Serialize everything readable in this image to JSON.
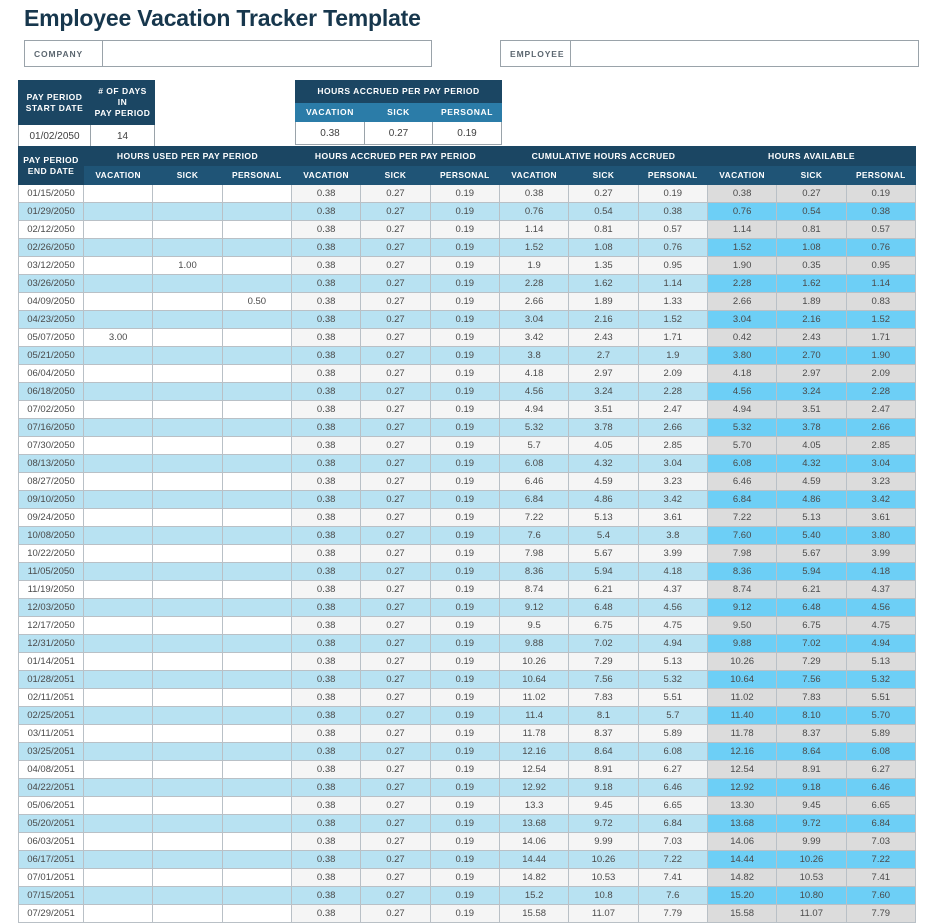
{
  "page_title": "Employee Vacation Tracker Template",
  "identity": {
    "company_label": "COMPANY",
    "company_value": "",
    "employee_label": "EMPLOYEE",
    "employee_value": ""
  },
  "pay_period_table": {
    "headers": [
      "PAY PERIOD START DATE",
      "# OF DAYS IN PAY PERIOD"
    ],
    "header_lines": [
      [
        "PAY PERIOD",
        "START DATE"
      ],
      [
        "# OF DAYS IN",
        "PAY PERIOD"
      ]
    ],
    "values": [
      "01/02/2050",
      "14"
    ]
  },
  "accrual_table": {
    "title": "HOURS ACCRUED PER PAY PERIOD",
    "columns": [
      "VACATION",
      "SICK",
      "PERSONAL"
    ],
    "values": [
      "0.38",
      "0.27",
      "0.19"
    ]
  },
  "main_table": {
    "date_header_lines": [
      "PAY PERIOD",
      "END DATE"
    ],
    "groups": [
      "HOURS USED PER PAY PERIOD",
      "HOURS ACCRUED PER PAY PERIOD",
      "CUMULATIVE HOURS ACCRUED",
      "HOURS AVAILABLE"
    ],
    "subcolumns": [
      "VACATION",
      "SICK",
      "PERSONAL"
    ],
    "rows": [
      {
        "date": "01/15/2050",
        "used": [
          "",
          "",
          ""
        ],
        "accrued": [
          "0.38",
          "0.27",
          "0.19"
        ],
        "cumulative": [
          "0.38",
          "0.27",
          "0.19"
        ],
        "available": [
          "0.38",
          "0.27",
          "0.19"
        ]
      },
      {
        "date": "01/29/2050",
        "used": [
          "",
          "",
          ""
        ],
        "accrued": [
          "0.38",
          "0.27",
          "0.19"
        ],
        "cumulative": [
          "0.76",
          "0.54",
          "0.38"
        ],
        "available": [
          "0.76",
          "0.54",
          "0.38"
        ]
      },
      {
        "date": "02/12/2050",
        "used": [
          "",
          "",
          ""
        ],
        "accrued": [
          "0.38",
          "0.27",
          "0.19"
        ],
        "cumulative": [
          "1.14",
          "0.81",
          "0.57"
        ],
        "available": [
          "1.14",
          "0.81",
          "0.57"
        ]
      },
      {
        "date": "02/26/2050",
        "used": [
          "",
          "",
          ""
        ],
        "accrued": [
          "0.38",
          "0.27",
          "0.19"
        ],
        "cumulative": [
          "1.52",
          "1.08",
          "0.76"
        ],
        "available": [
          "1.52",
          "1.08",
          "0.76"
        ]
      },
      {
        "date": "03/12/2050",
        "used": [
          "",
          "1.00",
          ""
        ],
        "accrued": [
          "0.38",
          "0.27",
          "0.19"
        ],
        "cumulative": [
          "1.9",
          "1.35",
          "0.95"
        ],
        "available": [
          "1.90",
          "0.35",
          "0.95"
        ]
      },
      {
        "date": "03/26/2050",
        "used": [
          "",
          "",
          ""
        ],
        "accrued": [
          "0.38",
          "0.27",
          "0.19"
        ],
        "cumulative": [
          "2.28",
          "1.62",
          "1.14"
        ],
        "available": [
          "2.28",
          "1.62",
          "1.14"
        ]
      },
      {
        "date": "04/09/2050",
        "used": [
          "",
          "",
          "0.50"
        ],
        "accrued": [
          "0.38",
          "0.27",
          "0.19"
        ],
        "cumulative": [
          "2.66",
          "1.89",
          "1.33"
        ],
        "available": [
          "2.66",
          "1.89",
          "0.83"
        ]
      },
      {
        "date": "04/23/2050",
        "used": [
          "",
          "",
          ""
        ],
        "accrued": [
          "0.38",
          "0.27",
          "0.19"
        ],
        "cumulative": [
          "3.04",
          "2.16",
          "1.52"
        ],
        "available": [
          "3.04",
          "2.16",
          "1.52"
        ]
      },
      {
        "date": "05/07/2050",
        "used": [
          "3.00",
          "",
          ""
        ],
        "accrued": [
          "0.38",
          "0.27",
          "0.19"
        ],
        "cumulative": [
          "3.42",
          "2.43",
          "1.71"
        ],
        "available": [
          "0.42",
          "2.43",
          "1.71"
        ]
      },
      {
        "date": "05/21/2050",
        "used": [
          "",
          "",
          ""
        ],
        "accrued": [
          "0.38",
          "0.27",
          "0.19"
        ],
        "cumulative": [
          "3.8",
          "2.7",
          "1.9"
        ],
        "available": [
          "3.80",
          "2.70",
          "1.90"
        ]
      },
      {
        "date": "06/04/2050",
        "used": [
          "",
          "",
          ""
        ],
        "accrued": [
          "0.38",
          "0.27",
          "0.19"
        ],
        "cumulative": [
          "4.18",
          "2.97",
          "2.09"
        ],
        "available": [
          "4.18",
          "2.97",
          "2.09"
        ]
      },
      {
        "date": "06/18/2050",
        "used": [
          "",
          "",
          ""
        ],
        "accrued": [
          "0.38",
          "0.27",
          "0.19"
        ],
        "cumulative": [
          "4.56",
          "3.24",
          "2.28"
        ],
        "available": [
          "4.56",
          "3.24",
          "2.28"
        ]
      },
      {
        "date": "07/02/2050",
        "used": [
          "",
          "",
          ""
        ],
        "accrued": [
          "0.38",
          "0.27",
          "0.19"
        ],
        "cumulative": [
          "4.94",
          "3.51",
          "2.47"
        ],
        "available": [
          "4.94",
          "3.51",
          "2.47"
        ]
      },
      {
        "date": "07/16/2050",
        "used": [
          "",
          "",
          ""
        ],
        "accrued": [
          "0.38",
          "0.27",
          "0.19"
        ],
        "cumulative": [
          "5.32",
          "3.78",
          "2.66"
        ],
        "available": [
          "5.32",
          "3.78",
          "2.66"
        ]
      },
      {
        "date": "07/30/2050",
        "used": [
          "",
          "",
          ""
        ],
        "accrued": [
          "0.38",
          "0.27",
          "0.19"
        ],
        "cumulative": [
          "5.7",
          "4.05",
          "2.85"
        ],
        "available": [
          "5.70",
          "4.05",
          "2.85"
        ]
      },
      {
        "date": "08/13/2050",
        "used": [
          "",
          "",
          ""
        ],
        "accrued": [
          "0.38",
          "0.27",
          "0.19"
        ],
        "cumulative": [
          "6.08",
          "4.32",
          "3.04"
        ],
        "available": [
          "6.08",
          "4.32",
          "3.04"
        ]
      },
      {
        "date": "08/27/2050",
        "used": [
          "",
          "",
          ""
        ],
        "accrued": [
          "0.38",
          "0.27",
          "0.19"
        ],
        "cumulative": [
          "6.46",
          "4.59",
          "3.23"
        ],
        "available": [
          "6.46",
          "4.59",
          "3.23"
        ]
      },
      {
        "date": "09/10/2050",
        "used": [
          "",
          "",
          ""
        ],
        "accrued": [
          "0.38",
          "0.27",
          "0.19"
        ],
        "cumulative": [
          "6.84",
          "4.86",
          "3.42"
        ],
        "available": [
          "6.84",
          "4.86",
          "3.42"
        ]
      },
      {
        "date": "09/24/2050",
        "used": [
          "",
          "",
          ""
        ],
        "accrued": [
          "0.38",
          "0.27",
          "0.19"
        ],
        "cumulative": [
          "7.22",
          "5.13",
          "3.61"
        ],
        "available": [
          "7.22",
          "5.13",
          "3.61"
        ]
      },
      {
        "date": "10/08/2050",
        "used": [
          "",
          "",
          ""
        ],
        "accrued": [
          "0.38",
          "0.27",
          "0.19"
        ],
        "cumulative": [
          "7.6",
          "5.4",
          "3.8"
        ],
        "available": [
          "7.60",
          "5.40",
          "3.80"
        ]
      },
      {
        "date": "10/22/2050",
        "used": [
          "",
          "",
          ""
        ],
        "accrued": [
          "0.38",
          "0.27",
          "0.19"
        ],
        "cumulative": [
          "7.98",
          "5.67",
          "3.99"
        ],
        "available": [
          "7.98",
          "5.67",
          "3.99"
        ]
      },
      {
        "date": "11/05/2050",
        "used": [
          "",
          "",
          ""
        ],
        "accrued": [
          "0.38",
          "0.27",
          "0.19"
        ],
        "cumulative": [
          "8.36",
          "5.94",
          "4.18"
        ],
        "available": [
          "8.36",
          "5.94",
          "4.18"
        ]
      },
      {
        "date": "11/19/2050",
        "used": [
          "",
          "",
          ""
        ],
        "accrued": [
          "0.38",
          "0.27",
          "0.19"
        ],
        "cumulative": [
          "8.74",
          "6.21",
          "4.37"
        ],
        "available": [
          "8.74",
          "6.21",
          "4.37"
        ]
      },
      {
        "date": "12/03/2050",
        "used": [
          "",
          "",
          ""
        ],
        "accrued": [
          "0.38",
          "0.27",
          "0.19"
        ],
        "cumulative": [
          "9.12",
          "6.48",
          "4.56"
        ],
        "available": [
          "9.12",
          "6.48",
          "4.56"
        ]
      },
      {
        "date": "12/17/2050",
        "used": [
          "",
          "",
          ""
        ],
        "accrued": [
          "0.38",
          "0.27",
          "0.19"
        ],
        "cumulative": [
          "9.5",
          "6.75",
          "4.75"
        ],
        "available": [
          "9.50",
          "6.75",
          "4.75"
        ]
      },
      {
        "date": "12/31/2050",
        "used": [
          "",
          "",
          ""
        ],
        "accrued": [
          "0.38",
          "0.27",
          "0.19"
        ],
        "cumulative": [
          "9.88",
          "7.02",
          "4.94"
        ],
        "available": [
          "9.88",
          "7.02",
          "4.94"
        ]
      },
      {
        "date": "01/14/2051",
        "used": [
          "",
          "",
          ""
        ],
        "accrued": [
          "0.38",
          "0.27",
          "0.19"
        ],
        "cumulative": [
          "10.26",
          "7.29",
          "5.13"
        ],
        "available": [
          "10.26",
          "7.29",
          "5.13"
        ]
      },
      {
        "date": "01/28/2051",
        "used": [
          "",
          "",
          ""
        ],
        "accrued": [
          "0.38",
          "0.27",
          "0.19"
        ],
        "cumulative": [
          "10.64",
          "7.56",
          "5.32"
        ],
        "available": [
          "10.64",
          "7.56",
          "5.32"
        ]
      },
      {
        "date": "02/11/2051",
        "used": [
          "",
          "",
          ""
        ],
        "accrued": [
          "0.38",
          "0.27",
          "0.19"
        ],
        "cumulative": [
          "11.02",
          "7.83",
          "5.51"
        ],
        "available": [
          "11.02",
          "7.83",
          "5.51"
        ]
      },
      {
        "date": "02/25/2051",
        "used": [
          "",
          "",
          ""
        ],
        "accrued": [
          "0.38",
          "0.27",
          "0.19"
        ],
        "cumulative": [
          "11.4",
          "8.1",
          "5.7"
        ],
        "available": [
          "11.40",
          "8.10",
          "5.70"
        ]
      },
      {
        "date": "03/11/2051",
        "used": [
          "",
          "",
          ""
        ],
        "accrued": [
          "0.38",
          "0.27",
          "0.19"
        ],
        "cumulative": [
          "11.78",
          "8.37",
          "5.89"
        ],
        "available": [
          "11.78",
          "8.37",
          "5.89"
        ]
      },
      {
        "date": "03/25/2051",
        "used": [
          "",
          "",
          ""
        ],
        "accrued": [
          "0.38",
          "0.27",
          "0.19"
        ],
        "cumulative": [
          "12.16",
          "8.64",
          "6.08"
        ],
        "available": [
          "12.16",
          "8.64",
          "6.08"
        ]
      },
      {
        "date": "04/08/2051",
        "used": [
          "",
          "",
          ""
        ],
        "accrued": [
          "0.38",
          "0.27",
          "0.19"
        ],
        "cumulative": [
          "12.54",
          "8.91",
          "6.27"
        ],
        "available": [
          "12.54",
          "8.91",
          "6.27"
        ]
      },
      {
        "date": "04/22/2051",
        "used": [
          "",
          "",
          ""
        ],
        "accrued": [
          "0.38",
          "0.27",
          "0.19"
        ],
        "cumulative": [
          "12.92",
          "9.18",
          "6.46"
        ],
        "available": [
          "12.92",
          "9.18",
          "6.46"
        ]
      },
      {
        "date": "05/06/2051",
        "used": [
          "",
          "",
          ""
        ],
        "accrued": [
          "0.38",
          "0.27",
          "0.19"
        ],
        "cumulative": [
          "13.3",
          "9.45",
          "6.65"
        ],
        "available": [
          "13.30",
          "9.45",
          "6.65"
        ]
      },
      {
        "date": "05/20/2051",
        "used": [
          "",
          "",
          ""
        ],
        "accrued": [
          "0.38",
          "0.27",
          "0.19"
        ],
        "cumulative": [
          "13.68",
          "9.72",
          "6.84"
        ],
        "available": [
          "13.68",
          "9.72",
          "6.84"
        ]
      },
      {
        "date": "06/03/2051",
        "used": [
          "",
          "",
          ""
        ],
        "accrued": [
          "0.38",
          "0.27",
          "0.19"
        ],
        "cumulative": [
          "14.06",
          "9.99",
          "7.03"
        ],
        "available": [
          "14.06",
          "9.99",
          "7.03"
        ]
      },
      {
        "date": "06/17/2051",
        "used": [
          "",
          "",
          ""
        ],
        "accrued": [
          "0.38",
          "0.27",
          "0.19"
        ],
        "cumulative": [
          "14.44",
          "10.26",
          "7.22"
        ],
        "available": [
          "14.44",
          "10.26",
          "7.22"
        ]
      },
      {
        "date": "07/01/2051",
        "used": [
          "",
          "",
          ""
        ],
        "accrued": [
          "0.38",
          "0.27",
          "0.19"
        ],
        "cumulative": [
          "14.82",
          "10.53",
          "7.41"
        ],
        "available": [
          "14.82",
          "10.53",
          "7.41"
        ]
      },
      {
        "date": "07/15/2051",
        "used": [
          "",
          "",
          ""
        ],
        "accrued": [
          "0.38",
          "0.27",
          "0.19"
        ],
        "cumulative": [
          "15.2",
          "10.8",
          "7.6"
        ],
        "available": [
          "15.20",
          "10.80",
          "7.60"
        ]
      },
      {
        "date": "07/29/2051",
        "used": [
          "",
          "",
          ""
        ],
        "accrued": [
          "0.38",
          "0.27",
          "0.19"
        ],
        "cumulative": [
          "15.58",
          "11.07",
          "7.79"
        ],
        "available": [
          "15.58",
          "11.07",
          "7.79"
        ]
      }
    ]
  },
  "colors": {
    "header_navy": "#1B4663",
    "subheader_navy": "#1F5476",
    "mini_subheader_blue": "#2B7CA8",
    "band_light_blue": "#B8E2F2",
    "available_cyan": "#6DCFF6",
    "available_gray": "#DCDCDC",
    "accrued_gray": "#F5F5F5",
    "title_color": "#17374D"
  }
}
